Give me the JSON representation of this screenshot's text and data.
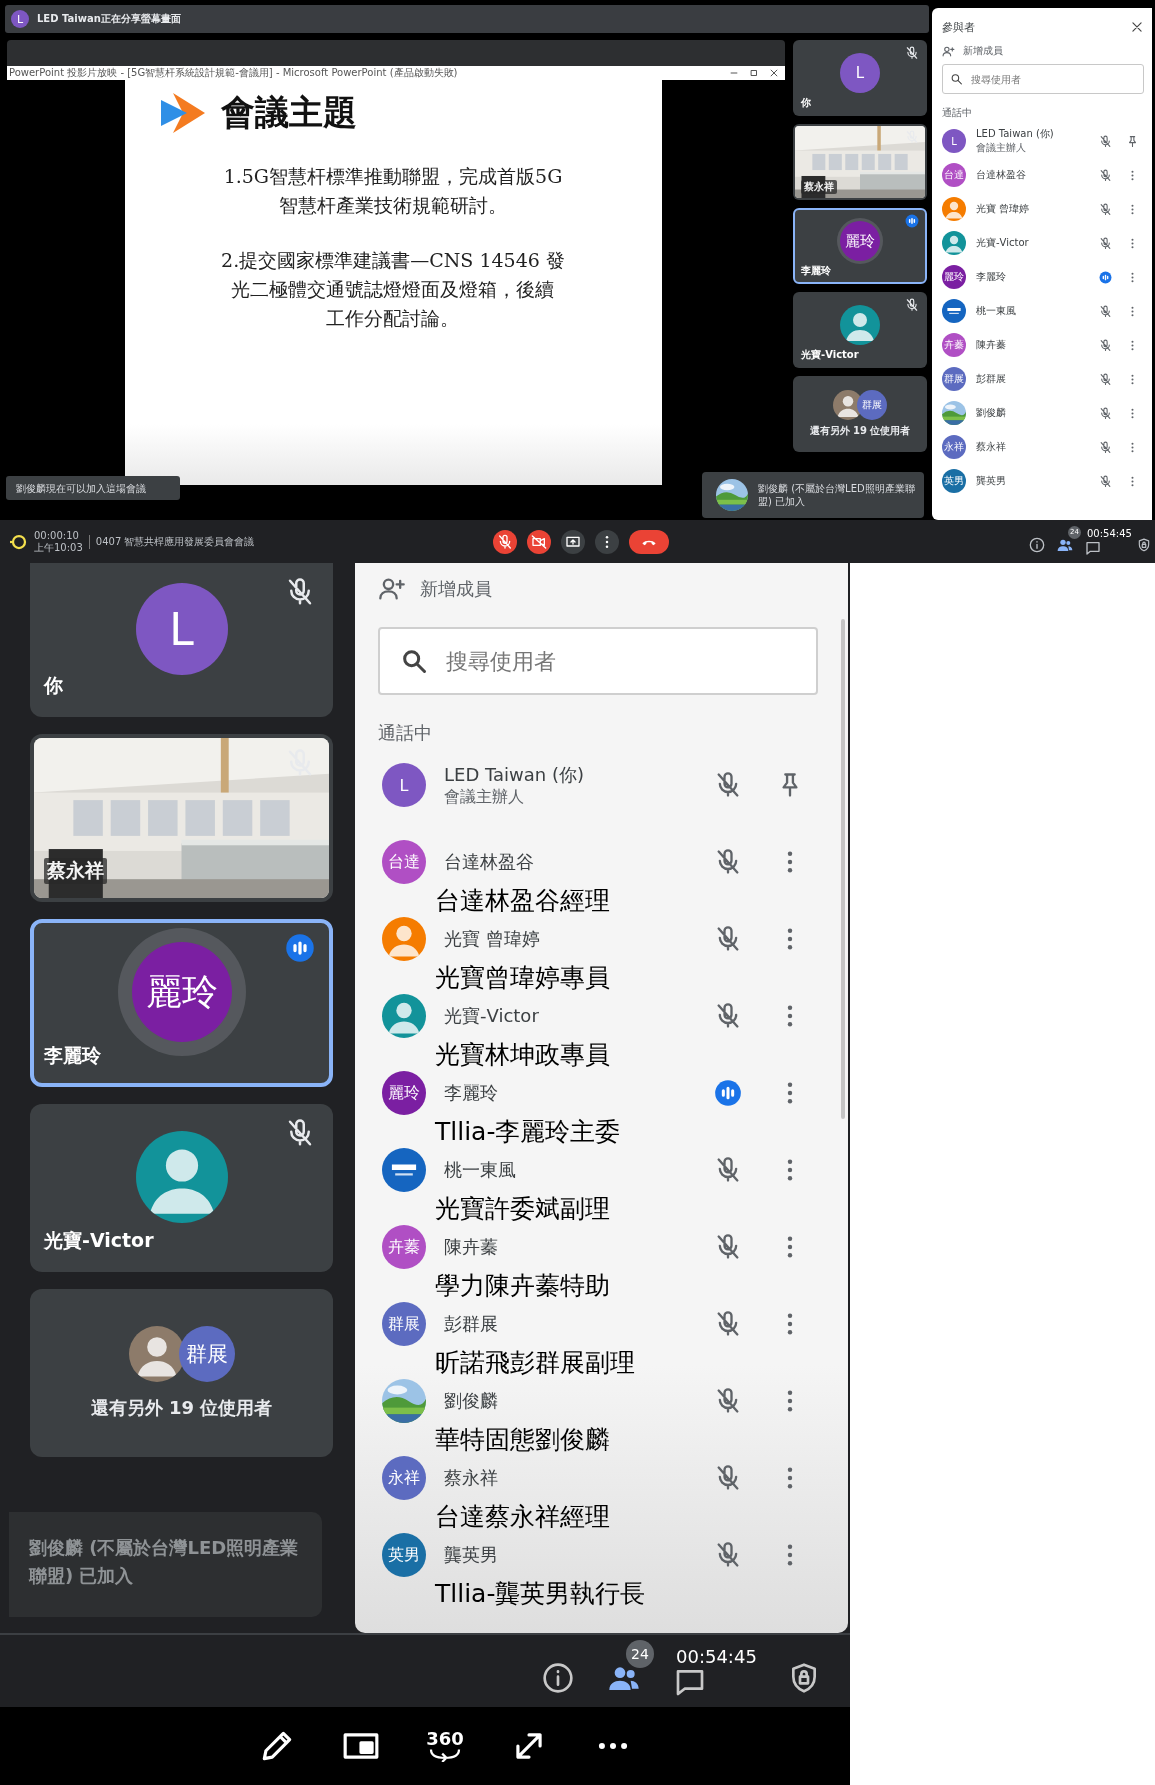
{
  "top": {
    "banner": {
      "avatar": {
        "kind": "initials",
        "text": "L",
        "color": "#7e57c2"
      },
      "text": "LED Taiwan正在分享螢幕畫面"
    },
    "shared_window": {
      "title": "PowerPoint 投影片放映 - [5G智慧杆系統設計規範-會議用] - Microsoft PowerPoint (產品啟動失敗)"
    },
    "slide": {
      "title": "會議主題",
      "paragraphs": [
        [
          "1.5G智慧杆標準推動聯盟，完成首版5G",
          "智慧杆產業技術規範研討。"
        ],
        [
          "2.提交國家標準建議書—CNS 14546 發",
          "光二極體交通號誌燈燈面及燈箱，後續",
          "工作分配討論。"
        ]
      ]
    },
    "tiles": [
      {
        "kind": "avatar",
        "avatar": {
          "kind": "initials",
          "text": "L",
          "color": "#7e57c2"
        },
        "name": "你",
        "muted": true,
        "speaking": false
      },
      {
        "kind": "video",
        "name": "蔡永祥",
        "muted": true,
        "speaking": false
      },
      {
        "kind": "avatar",
        "avatar": {
          "kind": "initials",
          "text": "麗玲",
          "color": "#7b1fa2"
        },
        "name": "李麗玲",
        "muted": false,
        "speaking": true
      },
      {
        "kind": "avatar",
        "avatar": {
          "kind": "person",
          "color": "#12939a"
        },
        "name": "光寶-Victor",
        "muted": true,
        "speaking": false
      },
      {
        "kind": "others",
        "avatars": [
          {
            "kind": "person",
            "color": "#8d7b6a"
          },
          {
            "kind": "initials",
            "text": "群展",
            "color": "#5c6bc0"
          }
        ],
        "caption": "還有另外 19 位使用者"
      }
    ],
    "notices": [
      {
        "text": "劉俊麟現在可以加入這場會議"
      },
      {
        "text": "劉俊麟 (不屬於台灣LED照明產業聯盟) 已加入"
      }
    ],
    "participants": {
      "title": "參與者",
      "add_label": "新增成員",
      "search_placeholder": "搜尋使用者",
      "section": "通話中",
      "rows": [
        {
          "kind": "host",
          "avatar": {
            "kind": "initials",
            "text": "L",
            "color": "#7e57c2"
          },
          "name": "LED Taiwan (你)",
          "role": "會議主辦人",
          "speaking": false
        },
        {
          "kind": "guest",
          "avatar": {
            "kind": "initials",
            "text": "台達",
            "color": "#b04fc4"
          },
          "name": "台達林盈谷",
          "speaking": false
        },
        {
          "kind": "guest",
          "avatar": {
            "kind": "person",
            "color": "#f57c00"
          },
          "name": "光寶 曾瑋婷",
          "speaking": false
        },
        {
          "kind": "guest",
          "avatar": {
            "kind": "person",
            "color": "#12939a"
          },
          "name": "光寶-Victor",
          "speaking": false
        },
        {
          "kind": "guest",
          "avatar": {
            "kind": "initials",
            "text": "麗玲",
            "color": "#7b1fa2"
          },
          "name": "李麗玲",
          "speaking": true
        },
        {
          "kind": "guest",
          "avatar": {
            "kind": "logo",
            "color": "#1565c0"
          },
          "name": "桃一東風",
          "speaking": false
        },
        {
          "kind": "guest",
          "avatar": {
            "kind": "initials",
            "text": "卉蓁",
            "color": "#b04fc4"
          },
          "name": "陳卉蓁",
          "speaking": false
        },
        {
          "kind": "guest",
          "avatar": {
            "kind": "initials",
            "text": "群展",
            "color": "#5c6bc0"
          },
          "name": "彭群展",
          "speaking": false
        },
        {
          "kind": "guest",
          "name": "劉俊麟",
          "speaking": false
        },
        {
          "kind": "guest",
          "avatar": {
            "kind": "initials",
            "text": "永祥",
            "color": "#5c6bc0"
          },
          "name": "蔡永祥",
          "speaking": false
        },
        {
          "kind": "guest",
          "avatar": {
            "kind": "initials",
            "text": "英男",
            "color": "#1a6fa5"
          },
          "name": "龔英男",
          "speaking": false
        }
      ]
    },
    "call_bar": {
      "recording_time": "00:00:10",
      "clock": "上午10:03",
      "meeting_title": "0407 智慧共桿應用發展委員會會議",
      "controls": [
        {
          "kind": "mic",
          "off": true
        },
        {
          "kind": "camera",
          "off": true
        },
        {
          "kind": "present",
          "off": false
        },
        {
          "kind": "more",
          "off": false
        },
        {
          "kind": "hangup"
        }
      ],
      "participant_count": "24",
      "elapsed": "00:54:45"
    }
  },
  "bottom": {
    "tiles": [
      {
        "kind": "avatar",
        "avatar": {
          "kind": "initials",
          "text": "L",
          "color": "#7e57c2"
        },
        "name": "你",
        "muted": true,
        "speaking": false
      },
      {
        "kind": "video",
        "name": "蔡永祥",
        "muted": true,
        "speaking": false
      },
      {
        "kind": "avatar",
        "avatar": {
          "kind": "initials",
          "text": "麗玲",
          "color": "#7b1fa2"
        },
        "name": "李麗玲",
        "muted": false,
        "speaking": true
      },
      {
        "kind": "avatar",
        "avatar": {
          "kind": "person",
          "color": "#12939a"
        },
        "name": "光寶-Victor",
        "muted": true,
        "speaking": false
      },
      {
        "kind": "others",
        "avatars": [
          {
            "kind": "person",
            "color": "#8d7b6a"
          },
          {
            "kind": "initials",
            "text": "群展",
            "color": "#5c6bc0"
          }
        ],
        "caption": "還有另外 19 位使用者"
      }
    ],
    "notice": {
      "text": "劉俊麟 (不屬於台灣LED照明產業聯盟) 已加入"
    },
    "participants": {
      "add_label": "新增成員",
      "search_placeholder": "搜尋使用者",
      "section": "通話中",
      "rows": [
        {
          "kind": "host",
          "avatar": {
            "kind": "initials",
            "text": "L",
            "color": "#7e57c2"
          },
          "name": "LED Taiwan (你)",
          "role": "會議主辦人",
          "speaking": false
        },
        {
          "kind": "guest",
          "avatar": {
            "kind": "initials",
            "text": "台達",
            "color": "#b04fc4"
          },
          "name": "台達林盈谷",
          "note": "台達林盈谷經理",
          "speaking": false
        },
        {
          "kind": "guest",
          "avatar": {
            "kind": "person",
            "color": "#f57c00"
          },
          "name": "光寶 曾瑋婷",
          "note": "光寶曾瑋婷專員",
          "speaking": false
        },
        {
          "kind": "guest",
          "avatar": {
            "kind": "person",
            "color": "#12939a"
          },
          "name": "光寶-Victor",
          "note": "光寶林坤政專員",
          "speaking": false
        },
        {
          "kind": "guest",
          "avatar": {
            "kind": "initials",
            "text": "麗玲",
            "color": "#7b1fa2"
          },
          "name": "李麗玲",
          "note": "Tllia-李麗玲主委",
          "speaking": true
        },
        {
          "kind": "guest",
          "avatar": {
            "kind": "logo",
            "color": "#1565c0"
          },
          "name": "桃一東風",
          "note": "光寶許委斌副理",
          "speaking": false
        },
        {
          "kind": "guest",
          "avatar": {
            "kind": "initials",
            "text": "卉蓁",
            "color": "#b04fc4"
          },
          "name": "陳卉蓁",
          "note": "學力陳卉蓁特助",
          "speaking": false
        },
        {
          "kind": "guest",
          "avatar": {
            "kind": "initials",
            "text": "群展",
            "color": "#5c6bc0"
          },
          "name": "彭群展",
          "note": "昕諾飛彭群展副理",
          "speaking": false
        },
        {
          "kind": "guest",
          "name": "劉俊麟",
          "note": "華特固態劉俊麟",
          "speaking": false
        },
        {
          "kind": "guest",
          "avatar": {
            "kind": "initials",
            "text": "永祥",
            "color": "#5c6bc0"
          },
          "name": "蔡永祥",
          "note": "台達蔡永祥經理",
          "speaking": false
        },
        {
          "kind": "guest",
          "avatar": {
            "kind": "initials",
            "text": "英男",
            "color": "#1a6fa5"
          },
          "name": "龔英男",
          "note": "Tllia-龔英男執行長",
          "speaking": false
        }
      ]
    },
    "status_bar": {
      "participant_count": "24",
      "elapsed": "00:54:45"
    },
    "toolbar": [
      {
        "kind": "pencil"
      },
      {
        "kind": "pip"
      },
      {
        "kind": "rotate",
        "label": "360"
      },
      {
        "kind": "expand"
      },
      {
        "kind": "more"
      }
    ]
  }
}
